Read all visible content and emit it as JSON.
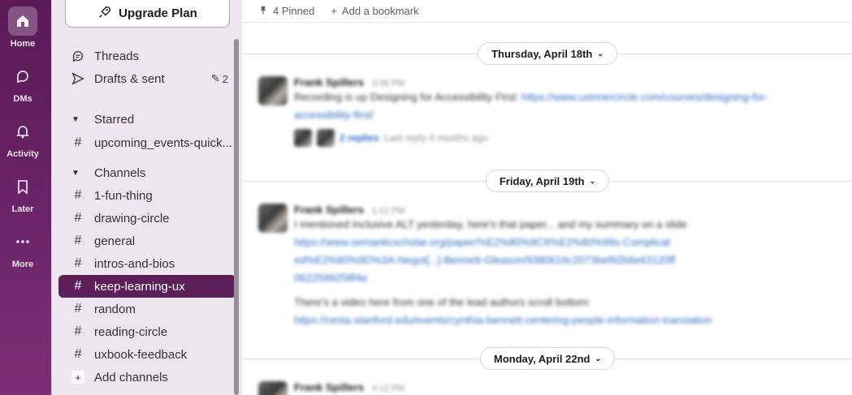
{
  "rail": {
    "items": [
      {
        "label": "Home",
        "icon": "home-icon",
        "active": true
      },
      {
        "label": "DMs",
        "icon": "dms-icon"
      },
      {
        "label": "Activity",
        "icon": "bell-icon"
      },
      {
        "label": "Later",
        "icon": "bookmark-icon"
      },
      {
        "label": "More",
        "icon": "more-icon"
      }
    ]
  },
  "sidebar": {
    "upgrade_label": "Upgrade Plan",
    "threads_label": "Threads",
    "drafts_label": "Drafts & sent",
    "drafts_count": "2",
    "starred_label": "Starred",
    "starred_items": [
      "upcoming_events-quick..."
    ],
    "channels_label": "Channels",
    "channels": [
      "1-fun-thing",
      "drawing-circle",
      "general",
      "intros-and-bios",
      "keep-learning-ux",
      "random",
      "reading-circle",
      "uxbook-feedback"
    ],
    "active_channel": "keep-learning-ux",
    "add_channels_label": "Add channels"
  },
  "main": {
    "pinned_label": "4 Pinned",
    "add_bookmark_label": "Add a bookmark",
    "dates": [
      "Thursday, April 18th",
      "Friday, April 19th",
      "Monday, April 22nd"
    ],
    "messages": [
      {
        "author": "Frank Spillers",
        "time": "3:38 PM",
        "text": "Recording is up Designing for Accessibility First: ",
        "link": "https://www.uxinnercircle.com/courses/designing-for-accessibility-first/",
        "replies": "2 replies",
        "last_reply": "Last reply 4 months ago"
      },
      {
        "author": "Frank Spillers",
        "time": "1:12 PM",
        "text": "I mentioned Inclusive ALT yesterday, here's that paper... and my summary on a slide",
        "link": "https://www.semanticscholar.org/paper/%E2%80%9CIt%E2%80%99s-Complicated%E2%80%9D%3A-Negot[...]-Bennett-Gleason/9380616c2073bef92b6e63120ff0622599258f4e",
        "text2": "There's a video here from one of the lead authors scroll bottom:",
        "link2": "https://cesta.stanford.edu/events/cynthia-bennett-centering-people-information-translation"
      },
      {
        "author": "Frank Spillers",
        "time": "4:12 PM"
      }
    ]
  },
  "colors": {
    "rail": "#5a1a58",
    "sidebar": "#ece6ee",
    "active_channel": "#5c1f5a",
    "link": "#2a6bbf"
  }
}
